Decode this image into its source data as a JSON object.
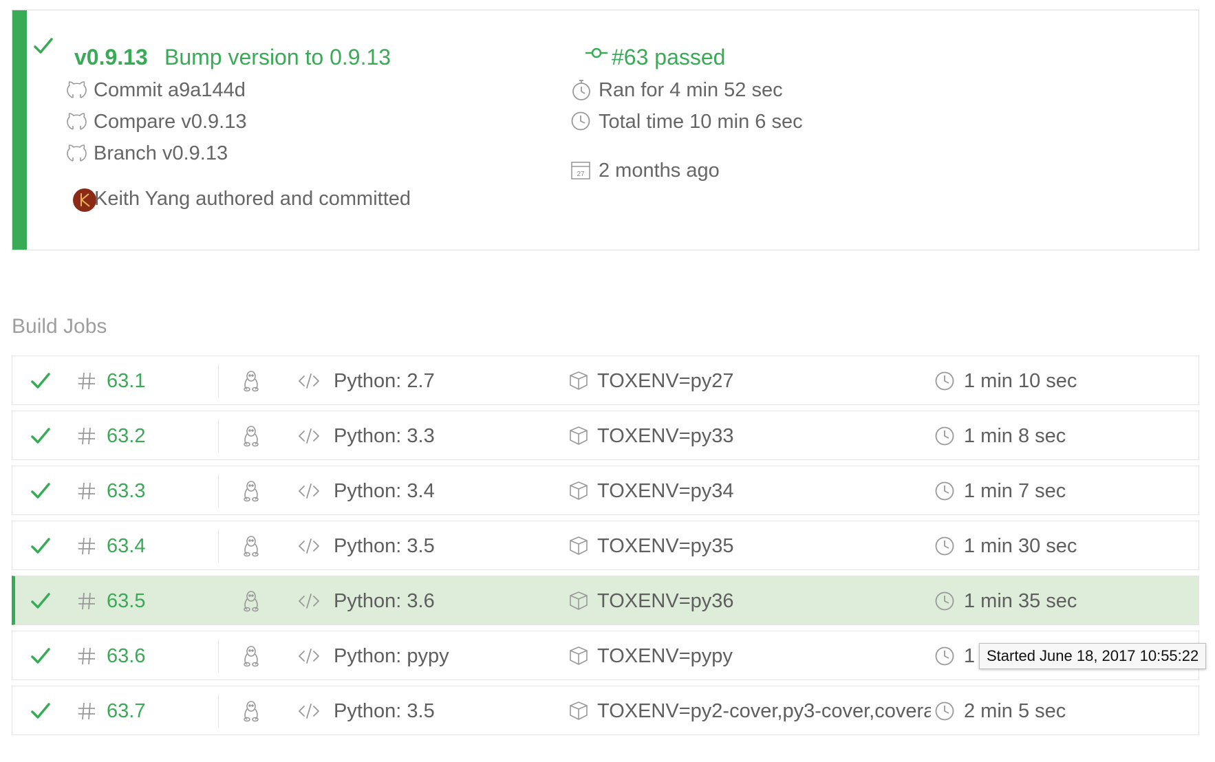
{
  "build": {
    "tag": "v0.9.13",
    "message": "Bump version to 0.9.13",
    "build_status": "#63 passed",
    "commit": "Commit a9a144d",
    "compare": "Compare v0.9.13",
    "branch": "Branch v0.9.13",
    "author": "Keith Yang authored and committed",
    "ran_for": "Ran for 4 min 52 sec",
    "total_time": "Total time 10 min 6 sec",
    "calendar_day": "27",
    "ago": "2 months ago"
  },
  "build_jobs": {
    "title": "Build Jobs",
    "jobs": [
      {
        "number": "63.1",
        "language": "Python: 2.7",
        "env": "TOXENV=py27",
        "duration": "1 min 10 sec"
      },
      {
        "number": "63.2",
        "language": "Python: 3.3",
        "env": "TOXENV=py33",
        "duration": "1 min 8 sec"
      },
      {
        "number": "63.3",
        "language": "Python: 3.4",
        "env": "TOXENV=py34",
        "duration": "1 min 7 sec"
      },
      {
        "number": "63.4",
        "language": "Python: 3.5",
        "env": "TOXENV=py35",
        "duration": "1 min 30 sec"
      },
      {
        "number": "63.5",
        "language": "Python: 3.6",
        "env": "TOXENV=py36",
        "duration": "1 min 35 sec"
      },
      {
        "number": "63.6",
        "language": "Python: pypy",
        "env": "TOXENV=pypy",
        "duration": "1 min 31 sec"
      },
      {
        "number": "63.7",
        "language": "Python: 3.5",
        "env": "TOXENV=py2-cover,py3-cover,coverage",
        "duration": "2 min 5 sec"
      }
    ]
  },
  "tooltip": "Started June 18, 2017 10:55:22",
  "colors": {
    "success": "#39aa56",
    "highlight_row": "#deecda",
    "text": "#666666",
    "icon": "#999999"
  }
}
